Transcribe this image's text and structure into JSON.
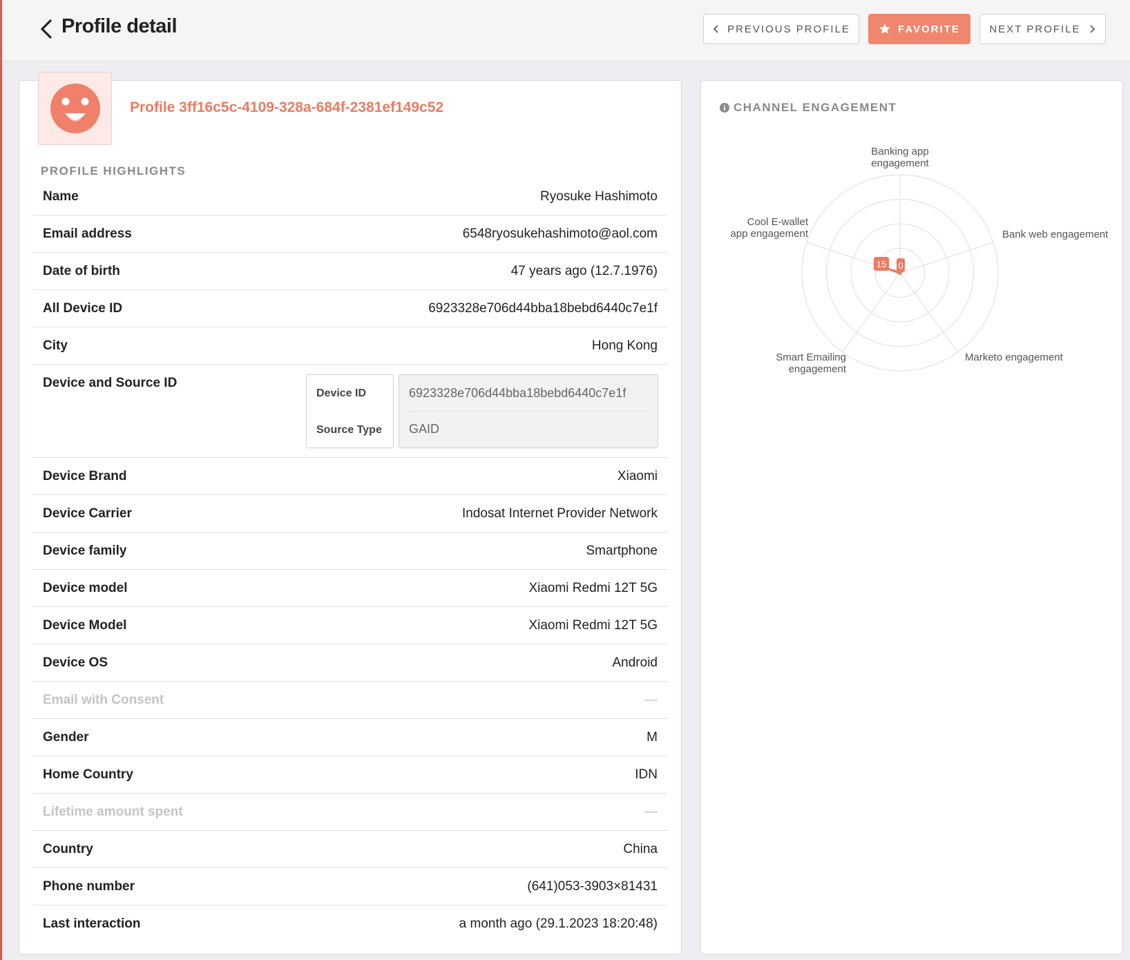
{
  "header": {
    "title": "Profile detail",
    "prev_label": "PREVIOUS PROFILE",
    "favorite_label": "FAVORITE",
    "next_label": "NEXT PROFILE"
  },
  "profile": {
    "id_label": "Profile 3ff16c5c-4109-328a-684f-2381ef149c52",
    "highlights_title": "PROFILE HIGHLIGHTS",
    "rows_top": [
      {
        "label": "Name",
        "value": "Ryosuke Hashimoto"
      },
      {
        "label": "Email address",
        "value": "6548ryosukehashimoto@aol.com"
      },
      {
        "label": "Date of birth",
        "value": "47 years ago (12.7.1976)"
      },
      {
        "label": "All Device ID",
        "value": "6923328e706d44bba18bebd6440c7e1f"
      },
      {
        "label": "City",
        "value": "Hong Kong"
      }
    ],
    "device_source": {
      "label": "Device and Source ID",
      "device_id_label": "Device ID",
      "device_id_value": "6923328e706d44bba18bebd6440c7e1f",
      "source_type_label": "Source Type",
      "source_type_value": "GAID"
    },
    "rows_bottom": [
      {
        "label": "Device Brand",
        "value": "Xiaomi"
      },
      {
        "label": "Device Carrier",
        "value": "Indosat Internet Provider Network"
      },
      {
        "label": "Device family",
        "value": "Smartphone"
      },
      {
        "label": "Device model",
        "value": "Xiaomi Redmi 12T 5G"
      },
      {
        "label": "Device Model",
        "value": "Xiaomi Redmi 12T 5G"
      },
      {
        "label": "Device OS",
        "value": "Android"
      },
      {
        "label": "Email with Consent",
        "value": "—"
      },
      {
        "label": "Gender",
        "value": "M"
      },
      {
        "label": "Home Country",
        "value": "IDN"
      },
      {
        "label": "Lifetime amount spent",
        "value": "—"
      },
      {
        "label": "Country",
        "value": "China"
      },
      {
        "label": "Phone number",
        "value": "(641)053-3903×81431"
      },
      {
        "label": "Last interaction",
        "value": "a month ago (29.1.2023 18:20:48)"
      }
    ]
  },
  "colors": {
    "accent": "#ec7b62",
    "favorite_bg": "#f0866d",
    "avatar_face": "#f0806a",
    "avatar_bg": "#fde9e5"
  },
  "chart_data": {
    "type": "radar",
    "title": "CHANNEL ENGAGEMENT",
    "axes": [
      [
        "Banking app",
        "engagement"
      ],
      [
        "Bank web engagement"
      ],
      [
        "Marketo engagement"
      ],
      [
        "Smart Emailing",
        "engagement"
      ],
      [
        "Cool E-wallet",
        "app engagement"
      ]
    ],
    "values": [
      0,
      0,
      0,
      0,
      15
    ],
    "data_labels": [
      "0",
      "15"
    ],
    "rmax": 100,
    "rings": 4
  }
}
